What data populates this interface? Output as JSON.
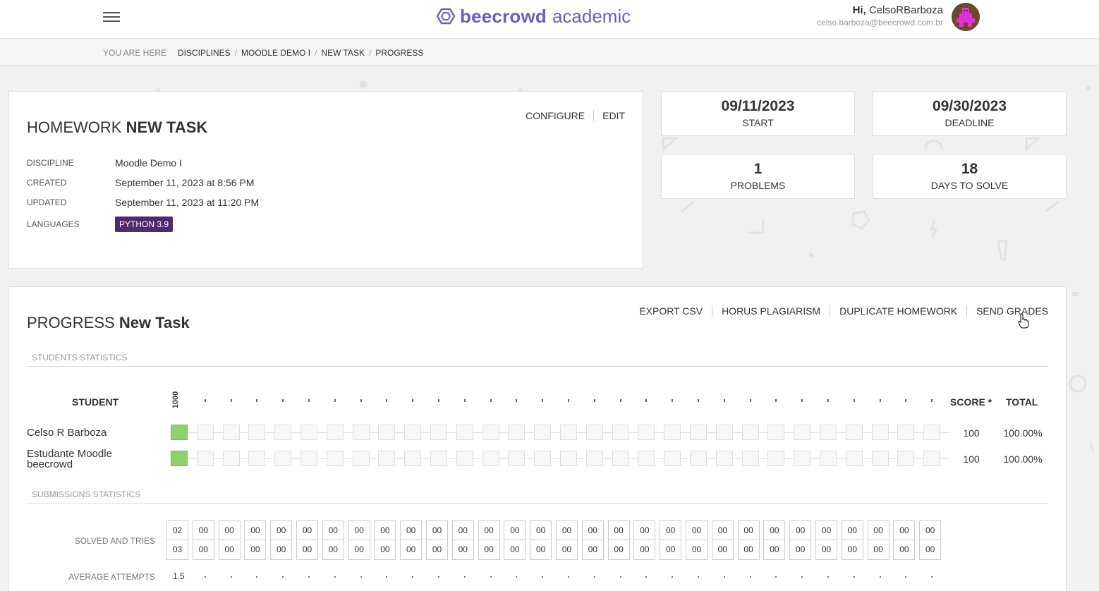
{
  "header": {
    "brand": "beecrowd",
    "brand_sub": "academic",
    "greeting": "Hi,",
    "username": "CelsoRBarboza",
    "email": "celso.barboza@beecrowd.com.br"
  },
  "breadcrumb": {
    "here_label": "YOU ARE HERE",
    "items": [
      "DISCIPLINES",
      "MOODLE DEMO I",
      "NEW TASK",
      "PROGRESS"
    ]
  },
  "task": {
    "title_prefix": "HOMEWORK",
    "title_name": "NEW TASK",
    "actions": [
      "CONFIGURE",
      "EDIT"
    ],
    "info": [
      {
        "key": "DISCIPLINE",
        "value": "Moodle Demo I"
      },
      {
        "key": "CREATED",
        "value": "September 11, 2023 at 8:56 PM"
      },
      {
        "key": "UPDATED",
        "value": "September 11, 2023 at 11:20 PM"
      }
    ],
    "languages_key": "LANGUAGES",
    "language_badge": "PYTHON 3.9"
  },
  "stats": [
    {
      "num": "09/11/2023",
      "label": "START"
    },
    {
      "num": "09/30/2023",
      "label": "DEADLINE"
    },
    {
      "num": "1",
      "label": "PROBLEMS"
    },
    {
      "num": "18",
      "label": "DAYS TO SOLVE"
    }
  ],
  "progress": {
    "title_prefix": "PROGRESS",
    "title_name": "New Task",
    "actions": [
      "EXPORT CSV",
      "HORUS PLAGIARISM",
      "DUPLICATE HOMEWORK",
      "SEND GRADES"
    ],
    "students_section": "STUDENTS STATISTICS",
    "submissions_section": "SUBMISSIONS STATISTICS",
    "col_student": "STUDENT",
    "col_score": "SCORE *",
    "col_total": "TOTAL",
    "problem_code": "1000",
    "students": [
      {
        "name_line1": "Celso R Barboza",
        "name_line2": "",
        "score": "100",
        "total": "100.00%",
        "solved": [
          true
        ]
      },
      {
        "name_line1": "Estudante Moodle",
        "name_line2": "beecrowd",
        "score": "100",
        "total": "100.00%",
        "solved": [
          true
        ]
      }
    ],
    "solved_label": "SOLVED AND TRIES",
    "solved": [
      "02",
      "00",
      "00",
      "00",
      "00",
      "00",
      "00",
      "00",
      "00",
      "00",
      "00",
      "00",
      "00",
      "00",
      "00",
      "00",
      "00",
      "00",
      "00",
      "00",
      "00",
      "00",
      "00",
      "00",
      "00",
      "00",
      "00",
      "00",
      "00",
      "00"
    ],
    "tries": [
      "03",
      "00",
      "00",
      "00",
      "00",
      "00",
      "00",
      "00",
      "00",
      "00",
      "00",
      "00",
      "00",
      "00",
      "00",
      "00",
      "00",
      "00",
      "00",
      "00",
      "00",
      "00",
      "00",
      "00",
      "00",
      "00",
      "00",
      "00",
      "00",
      "00"
    ],
    "avg_label": "AVERAGE ATTEMPTS",
    "avg_first": "1.5"
  },
  "colors": {
    "brand": "#6a5fc1",
    "badge": "#4e2a6e",
    "solved_cell": "#8fd16a"
  }
}
